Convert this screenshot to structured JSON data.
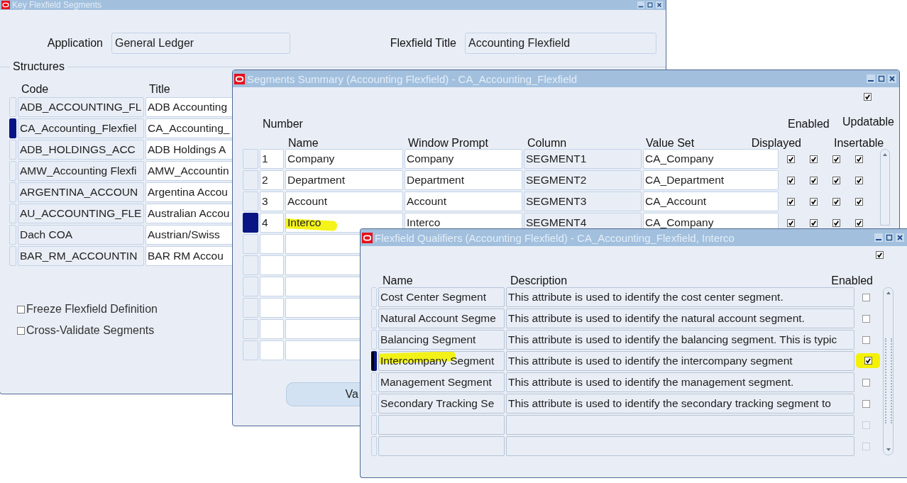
{
  "key_flexfield_window": {
    "title": "Key Flexfield Segments",
    "application_label": "Application",
    "application_value": "General Ledger",
    "flexfield_title_label": "Flexfield Title",
    "flexfield_title_value": "Accounting Flexfield",
    "structures_label": "Structures",
    "columns": [
      "Code",
      "Title"
    ],
    "rows": [
      {
        "code": "ADB_ACCOUNTING_FL",
        "title": "ADB Accounting",
        "selected": false
      },
      {
        "code": "CA_Accounting_Flexfiel",
        "title": "CA_Accounting_",
        "selected": true
      },
      {
        "code": "ADB_HOLDINGS_ACC",
        "title": "ADB Holdings A",
        "selected": false
      },
      {
        "code": "AMW_Accounting Flexfi",
        "title": "AMW_Accountin",
        "selected": false
      },
      {
        "code": "ARGENTINA_ACCOUN",
        "title": "Argentina Accou",
        "selected": false
      },
      {
        "code": "AU_ACCOUNTING_FLE",
        "title": "Australian Accou",
        "selected": false
      },
      {
        "code": "Dach COA",
        "title": "Austrian/Swiss",
        "selected": false
      },
      {
        "code": "BAR_RM_ACCOUNTIN",
        "title": "BAR RM Accou",
        "selected": false
      }
    ],
    "checkboxes": [
      {
        "label": "Freeze Flexfield Definition",
        "checked": false
      },
      {
        "label": "Cross-Validate Segments",
        "checked": false
      }
    ]
  },
  "segments_window": {
    "title": "Segments Summary (Accounting Flexfield) - CA_Accounting_Flexfield",
    "checked": true,
    "headers": {
      "number": "Number",
      "name": "Name",
      "prompt": "Window Prompt",
      "column": "Column",
      "value_set": "Value Set",
      "displayed": "Displayed",
      "enabled": "Enabled",
      "updatable": "Updatable",
      "insertable": "Insertable"
    },
    "rows": [
      {
        "number": "1",
        "name": "Company",
        "prompt": "Company",
        "column": "SEGMENT1",
        "value_set": "CA_Company",
        "displayed": true,
        "enabled": true,
        "updatable": true,
        "insertable": true,
        "selected": false,
        "highlighted": false
      },
      {
        "number": "2",
        "name": "Department",
        "prompt": "Department",
        "column": "SEGMENT2",
        "value_set": "CA_Department",
        "displayed": true,
        "enabled": true,
        "updatable": true,
        "insertable": true,
        "selected": false,
        "highlighted": false
      },
      {
        "number": "3",
        "name": "Account",
        "prompt": "Account",
        "column": "SEGMENT3",
        "value_set": "CA_Account",
        "displayed": true,
        "enabled": true,
        "updatable": true,
        "insertable": true,
        "selected": false,
        "highlighted": false
      },
      {
        "number": "4",
        "name": "Interco",
        "prompt": "Interco",
        "column": "SEGMENT4",
        "value_set": "CA_Company",
        "displayed": true,
        "enabled": true,
        "updatable": true,
        "insertable": true,
        "selected": true,
        "highlighted": true
      }
    ],
    "button": "Va"
  },
  "qualifiers_window": {
    "title": "Flexfield Qualifiers (Accounting Flexfield) - CA_Accounting_Flexfield, Interco",
    "checked": true,
    "columns": [
      "Name",
      "Description",
      "Enabled"
    ],
    "rows": [
      {
        "name": "Cost Center Segment",
        "description": "This attribute is used to identify the cost center segment.",
        "enabled": false,
        "disabled": false,
        "selected": false,
        "highlighted": false
      },
      {
        "name": "Natural Account Segme",
        "description": "This attribute is used to identify the natural account segment.",
        "enabled": false,
        "disabled": false,
        "selected": false,
        "highlighted": false
      },
      {
        "name": "Balancing Segment",
        "description": "This attribute is used to identify the balancing segment. This is typic",
        "enabled": false,
        "disabled": false,
        "selected": false,
        "highlighted": false
      },
      {
        "name": "Intercompany Segment",
        "description": "This attribute is used to identify the intercompany segment",
        "enabled": true,
        "disabled": false,
        "selected": true,
        "highlighted": true
      },
      {
        "name": "Management Segment",
        "description": "This attribute is used to identify the management segment.",
        "enabled": false,
        "disabled": false,
        "selected": false,
        "highlighted": false
      },
      {
        "name": "Secondary Tracking Se",
        "description": "This attribute is used to identify the secondary tracking segment to",
        "enabled": false,
        "disabled": false,
        "selected": false,
        "highlighted": false
      },
      {
        "enabled": false,
        "disabled": true,
        "selected": false,
        "highlighted": false
      },
      {
        "enabled": false,
        "disabled": true,
        "selected": false,
        "highlighted": false
      }
    ]
  }
}
